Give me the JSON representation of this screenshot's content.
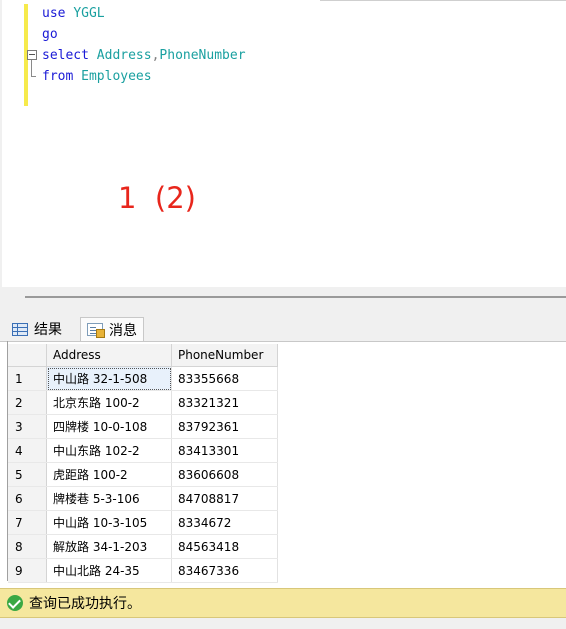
{
  "editor": {
    "lines": [
      {
        "parts": [
          {
            "t": "use ",
            "c": "kw"
          },
          {
            "t": "YGGL",
            "c": "tb"
          }
        ]
      },
      {
        "parts": [
          {
            "t": "go",
            "c": "kw"
          }
        ]
      },
      {
        "parts": [
          {
            "t": "select ",
            "c": "kw"
          },
          {
            "t": "Address",
            "c": "tb"
          },
          {
            "t": ",",
            "c": "gy"
          },
          {
            "t": "PhoneNumber",
            "c": "tb"
          }
        ]
      },
      {
        "parts": [
          {
            "t": "from ",
            "c": "kw"
          },
          {
            "t": "Employees",
            "c": "tb"
          }
        ]
      }
    ],
    "annotation": "1  (2)"
  },
  "tabs": {
    "results": "结果",
    "messages": "消息"
  },
  "grid": {
    "columns": [
      "Address",
      "PhoneNumber"
    ],
    "rows": [
      {
        "n": "1",
        "address": "中山路 32-1-508",
        "phone": "83355668"
      },
      {
        "n": "2",
        "address": "北京东路 100-2",
        "phone": "83321321"
      },
      {
        "n": "3",
        "address": "四牌楼 10-0-108",
        "phone": "83792361"
      },
      {
        "n": "4",
        "address": "中山东路 102-2",
        "phone": "83413301"
      },
      {
        "n": "5",
        "address": "虎距路 100-2",
        "phone": "83606608"
      },
      {
        "n": "6",
        "address": "牌楼巷 5-3-106",
        "phone": "84708817"
      },
      {
        "n": "7",
        "address": "中山路 10-3-105",
        "phone": "8334672"
      },
      {
        "n": "8",
        "address": "解放路 34-1-203",
        "phone": "84563418"
      },
      {
        "n": "9",
        "address": "中山北路 24-35",
        "phone": "83467336"
      }
    ]
  },
  "status": {
    "message": "查询已成功执行。"
  },
  "colors": {
    "keyword": "#1a1ad6",
    "identifier": "#1aa0a0",
    "annotation": "#e8261c",
    "status_bg": "#f5e79e"
  }
}
